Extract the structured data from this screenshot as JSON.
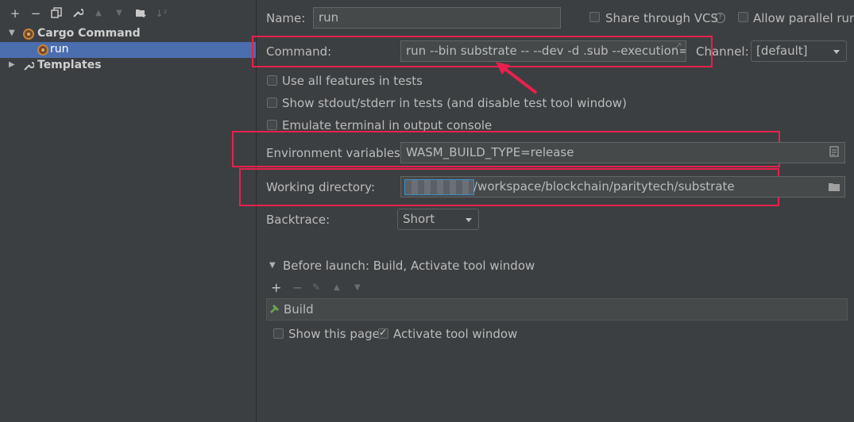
{
  "toolbar": {
    "icons": [
      "add-icon",
      "remove-icon",
      "copy-icon",
      "wrench-icon",
      "move-up-icon",
      "move-down-icon",
      "folder-add-icon",
      "sort-icon"
    ]
  },
  "tree": {
    "items": [
      {
        "label": "Cargo Command",
        "icon": "cargo-icon",
        "expanded": true
      },
      {
        "label": "run",
        "icon": "cargo-icon",
        "selected": true
      },
      {
        "label": "Templates",
        "icon": "wrench-icon",
        "expanded": false
      }
    ]
  },
  "form": {
    "name_label": "Name:",
    "name_value": "run",
    "share_vcs_label": "Share through VCS",
    "allow_parallel_label": "Allow parallel run",
    "command_label": "Command:",
    "command_value": "run --bin substrate -- --dev -d .sub --execution=Na",
    "channel_label": "Channel:",
    "channel_value": "[default]",
    "use_all_features_label": "Use all features in tests",
    "show_stdout_label": "Show stdout/stderr in tests (and disable test tool window)",
    "emulate_terminal_label": "Emulate terminal in output console",
    "env_vars_label": "Environment variables:",
    "env_vars_value": "WASM_BUILD_TYPE=release",
    "working_dir_label": "Working directory:",
    "working_dir_value": "/workspace/blockchain/paritytech/substrate",
    "backtrace_label": "Backtrace:",
    "backtrace_value": "Short"
  },
  "before_launch": {
    "header": "Before launch: Build, Activate tool window",
    "items": [
      {
        "label": "Build",
        "icon": "hammer-icon"
      }
    ],
    "show_this_page_label": "Show this page",
    "activate_tool_window_label": "Activate tool window"
  },
  "colors": {
    "background": "#3c3f41",
    "selection": "#4b6eaf",
    "highlight_annotation": "#e8204e"
  }
}
